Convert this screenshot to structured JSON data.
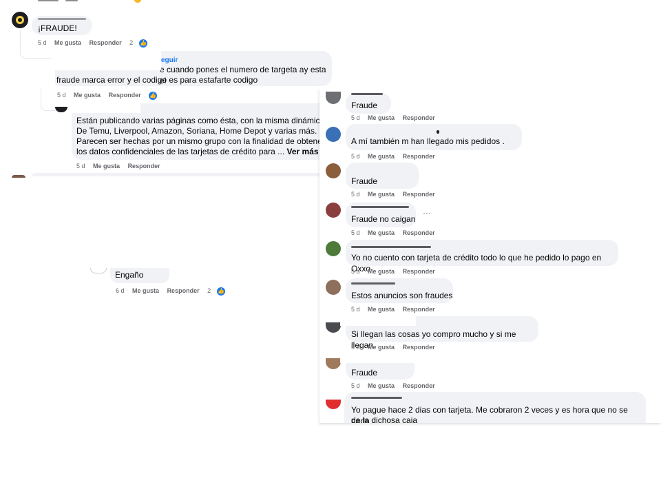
{
  "left_panel": {
    "top_comment": {
      "text": "¡FRAUDE!",
      "time": "5 d",
      "like": "Me gusta",
      "reply": "Responder",
      "reaction_count": "2"
    },
    "reply_1": {
      "follow": "eguir",
      "line1": "e cuando pones el numero de targeta ay esta el",
      "line2": "fraude marca error y el codigo es para estafarte codigo",
      "time": "5 d",
      "like": "Me gusta",
      "reply": "Responder"
    },
    "reply_2": {
      "line1": "Están publicando varias páginas como ésta, con la misma dinámica.",
      "line2": "De Temu, Liverpool, Amazon, Soriana, Home Depot y varias más.",
      "line3": "Parecen ser hechas por un mismo grupo con la finalidad de obtener",
      "line4": "los datos confidenciales de las tarjetas de crédito para ...",
      "see_more": "Ver más",
      "time": "5 d",
      "like": "Me gusta",
      "reply": "Responder"
    },
    "engano": {
      "text": "Engaño",
      "time": "6 d",
      "like": "Me gusta",
      "reply": "Responder",
      "reaction_count": "2"
    }
  },
  "right_panel": {
    "comments": [
      {
        "text": "Fraude",
        "time": "5 d",
        "like": "Me gusta",
        "reply": "Responder"
      },
      {
        "text": "A mí también m han llegado mis pedidos .",
        "time": "5 d",
        "like": "Me gusta",
        "reply": "Responder"
      },
      {
        "text": "Fraude",
        "time": "5 d",
        "like": "Me gusta",
        "reply": "Responder"
      },
      {
        "text": "Fraude no caigan",
        "time": "5 d",
        "like": "Me gusta",
        "reply": "Responder",
        "more": "···"
      },
      {
        "text": "Yo no cuento con tarjeta de crédito todo lo que he pedido lo pago en Oxxo",
        "time": "5 d",
        "like": "Me gusta",
        "reply": "Responder"
      },
      {
        "text": "Estos anuncios son fraudes",
        "time": "5 d",
        "like": "Me gusta",
        "reply": "Responder"
      },
      {
        "text": "Si llegan las cosas yo compro mucho y si me llegan",
        "time": "5 d",
        "like": "Me gusta",
        "reply": "Responder"
      },
      {
        "text": "Fraude",
        "time": "5 d",
        "like": "Me gusta",
        "reply": "Responder"
      }
    ],
    "last_comment": {
      "line1": "Yo pague hace 2 dias con tarjeta. Me cobraron 2 veces y es hora que no se nada",
      "line2": "de la dichosa caja"
    }
  },
  "icons": {
    "like": "thumbs-up-icon",
    "more": "ellipsis-icon"
  },
  "colors": {
    "bubble": "#f0f2f5",
    "meta_text": "#65676b",
    "like_blue": "#1877f2"
  }
}
